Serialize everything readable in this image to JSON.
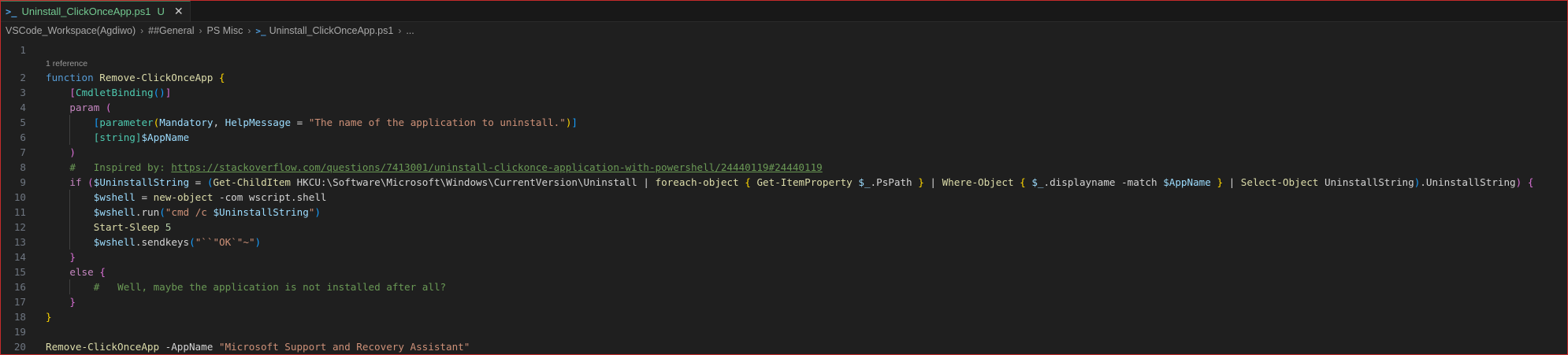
{
  "tab": {
    "icon": "powershell-icon",
    "filename": "Uninstall_ClickOnceApp.ps1",
    "status": "U",
    "close": "✕"
  },
  "breadcrumb": {
    "items": [
      "VSCode_Workspace(Agdiwo)",
      "##General",
      "PS Misc",
      "Uninstall_ClickOnceApp.ps1",
      "..."
    ]
  },
  "codelens": "1 reference",
  "line_numbers": [
    "1",
    "2",
    "3",
    "4",
    "5",
    "6",
    "7",
    "8",
    "9",
    "10",
    "11",
    "12",
    "13",
    "14",
    "15",
    "16",
    "17",
    "18",
    "19",
    "20"
  ],
  "code": {
    "l2_kw": "function",
    "l2_name": "Remove-ClickOnceApp",
    "l3_attr": "CmdletBinding",
    "l4_param": "param",
    "l5_attr": "parameter",
    "l5_mandatory": "Mandatory",
    "l5_helpmsg": "HelpMessage",
    "l5_eq": " = ",
    "l5_str": "\"The name of the application to uninstall.\"",
    "l6_type": "[string]",
    "l6_var": "$AppName",
    "l8_cmt": "#   Inspired by: ",
    "l8_link": "https://stackoverflow.com/questions/7413001/uninstall-clickonce-application-with-powershell/24440119#24440119",
    "l9_if": "if",
    "l9_var": "$UninstallString",
    "l9_eq": " = ",
    "l9_cmd1": "Get-ChildItem",
    "l9_path": " HKCU:\\Software\\Microsoft\\Windows\\CurrentVersion\\Uninstall ",
    "l9_pipe1": "| ",
    "l9_foreach": "foreach-object",
    "l9_getitem": "Get-ItemProperty",
    "l9_psvar": "$_",
    "l9_pspath": ".PsPath ",
    "l9_pipe2": " | ",
    "l9_where": "Where-Object",
    "l9_psvar2": "$_",
    "l9_disp": ".displayname ",
    "l9_match": "-match",
    "l9_appname": "$AppName",
    "l9_pipe3": " | ",
    "l9_select": "Select-Object",
    "l9_prop": " UninstallString",
    "l9_tail": ".UninstallString",
    "l10_var": "$wshell",
    "l10_eq": " = ",
    "l10_new": "new-object",
    "l10_rest": " -com wscript.shell",
    "l11_var": "$wshell",
    "l11_run": ".run",
    "l11_str1": "\"cmd /c ",
    "l11_strvar": "$UninstallString",
    "l11_str2": "\"",
    "l12_cmd": "Start-Sleep",
    "l12_num": " 5",
    "l13_var": "$wshell",
    "l13_send": ".sendkeys",
    "l13_str": "\"``\"OK`\"~\"",
    "l15_else": "else",
    "l16_cmt": "#   Well, maybe the application is not installed after all?",
    "l20_cmd": "Remove-ClickOnceApp",
    "l20_param": " -AppName ",
    "l20_str": "\"Microsoft Support and Recovery Assistant\""
  },
  "colors": {
    "background": "#1f1f1f",
    "keyword": "#c586c0",
    "string": "#ce9178",
    "comment": "#6a9955",
    "variable": "#9cdcfe",
    "function": "#dcdcaa",
    "modified": "#73c991"
  }
}
